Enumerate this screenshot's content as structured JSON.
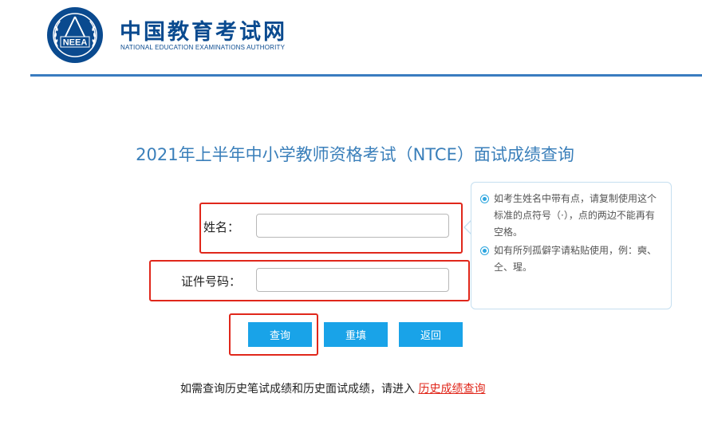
{
  "header": {
    "logo_text": "NEEA",
    "site_name_cn": "中国教育考试网",
    "site_name_en": "NATIONAL EDUCATION EXAMINATIONS AUTHORITY"
  },
  "page_title": "2021年上半年中小学教师资格考试（NTCE）面试成绩查询",
  "form": {
    "name_label": "姓名：",
    "name_value": "",
    "id_label": "证件号码：",
    "id_value": ""
  },
  "tips": [
    "如考生姓名中带有点，请复制使用这个标准的点符号（·），点的两边不能再有空格。",
    "如有所列孤僻字请粘贴使用，例：奭、仝、瑆。"
  ],
  "buttons": {
    "query": "查询",
    "reset": "重填",
    "back": "返回"
  },
  "footer": {
    "text": "如需查询历史笔试成绩和历史面试成绩，请进入",
    "link": "历史成绩查询"
  },
  "colors": {
    "brand": "#0a4a8f",
    "title": "#3a7fba",
    "button": "#19a3e8",
    "highlight": "#e0271b"
  }
}
